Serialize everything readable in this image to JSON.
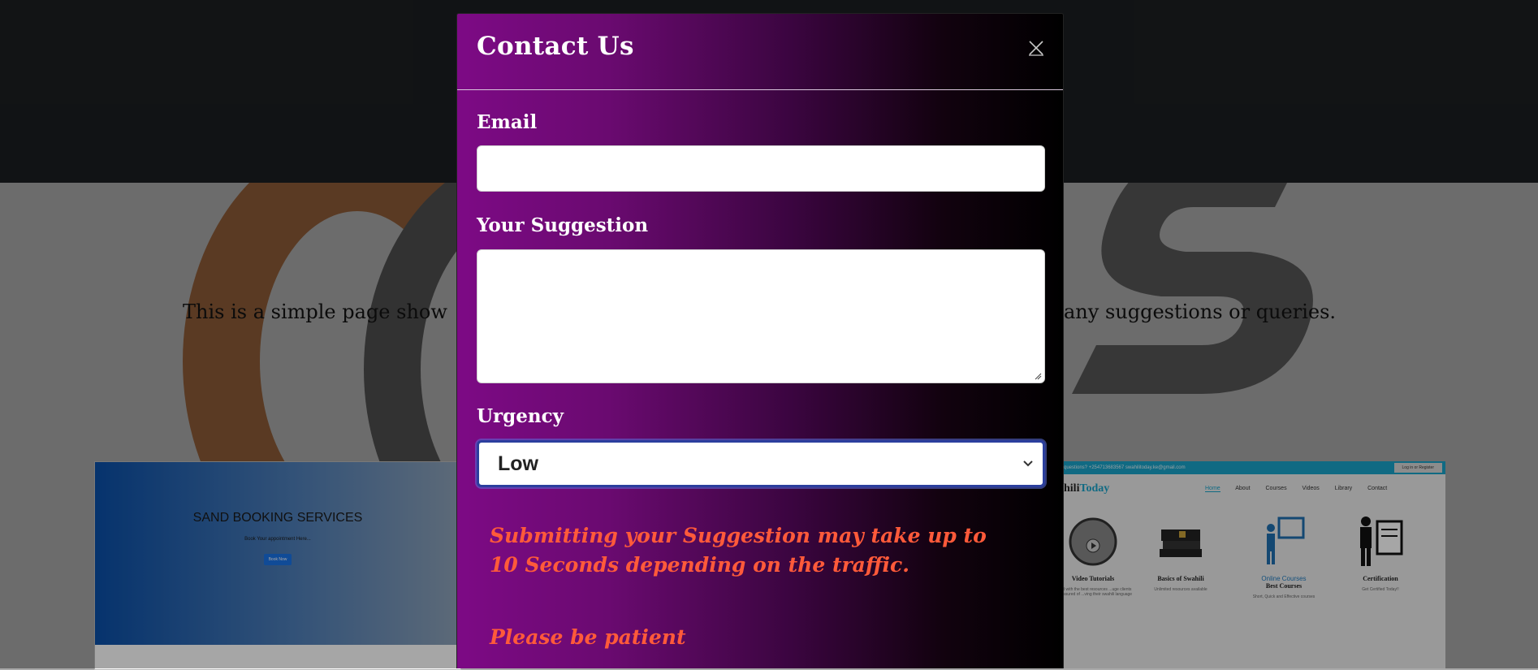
{
  "background_page": {
    "intro_left": "This is a simple page show",
    "intro_right": "any suggestions or queries.",
    "left_card": {
      "title": "SAND BOOKING SERVICES",
      "subtitle": "Book Your appointment Here...",
      "button": "Book Now"
    },
    "right_card": {
      "top_strip": "questions?   +254713683567   swahilitoday.ke@gmail.com",
      "login": "Log in or Register",
      "brand_prefix": "hili",
      "brand_suffix": "Today",
      "nav": [
        "Home",
        "About",
        "Courses",
        "Videos",
        "Library",
        "Contact"
      ],
      "features": [
        {
          "icon": "video-tutorial-icon",
          "title": "Video Tutorials",
          "text": "...and with the best resources ...uge clients are assured of ...ving their swahili language"
        },
        {
          "icon": "books-icon",
          "title": "Basics of Swahili",
          "text": "Unlimited resources available"
        },
        {
          "icon": "teacher-board-icon",
          "caption": "Online Courses",
          "title": "Best Courses",
          "text": "Short, Quick and Effective courses"
        },
        {
          "icon": "certificate-icon",
          "title": "Certification",
          "text": "Get Certified Today!!"
        }
      ]
    }
  },
  "modal": {
    "title": "Contact Us",
    "close_icon": "close-icon",
    "email_label": "Email",
    "email_value": "",
    "suggestion_label": "Your Suggestion",
    "suggestion_value": "",
    "urgency_label": "Urgency",
    "urgency_selected": "Low",
    "note_traffic": "Submitting your Suggestion may take up to 10 Seconds depending on the traffic.",
    "note_patient": "Please be patient"
  },
  "colors": {
    "modal_gradient_start": "#7d0a85",
    "modal_gradient_end": "#000000",
    "note_text": "#ff5a3a",
    "select_focus_border": "#2b3f9e"
  }
}
